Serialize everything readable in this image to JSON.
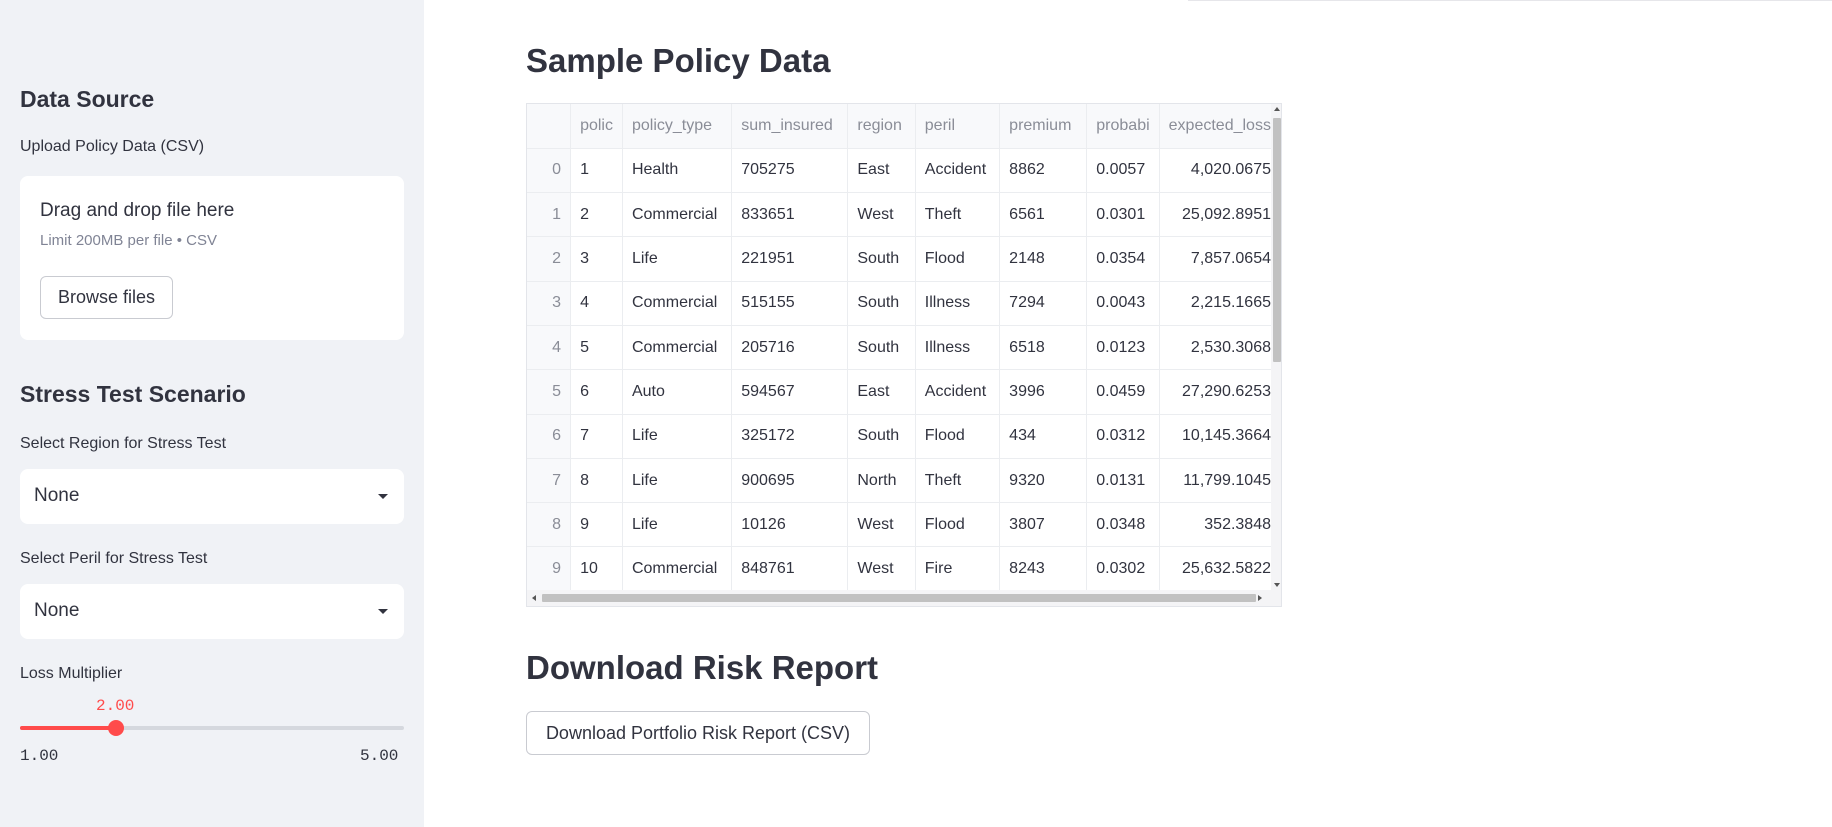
{
  "sidebar": {
    "data_source_heading": "Data Source",
    "upload_label": "Upload Policy Data (CSV)",
    "uploader": {
      "drag_text": "Drag and drop file here",
      "limit_text": "Limit 200MB per file • CSV",
      "browse_label": "Browse files"
    },
    "stress_heading": "Stress Test Scenario",
    "region_label": "Select Region for Stress Test",
    "region_value": "None",
    "peril_label": "Select Peril for Stress Test",
    "peril_value": "None",
    "multiplier_label": "Loss Multiplier",
    "multiplier": {
      "value": "2.00",
      "min": "1.00",
      "max": "5.00",
      "fraction": 0.25
    }
  },
  "main": {
    "sample_title": "Sample Policy Data",
    "table": {
      "columns": [
        "",
        "polic",
        "policy_type",
        "sum_insured",
        "region",
        "peril",
        "premium",
        "probabi",
        "expected_loss"
      ],
      "rows": [
        [
          "0",
          "1",
          "Health",
          "705275",
          "East",
          "Accident",
          "8862",
          "0.0057",
          "4,020.0675"
        ],
        [
          "1",
          "2",
          "Commercial",
          "833651",
          "West",
          "Theft",
          "6561",
          "0.0301",
          "25,092.8951"
        ],
        [
          "2",
          "3",
          "Life",
          "221951",
          "South",
          "Flood",
          "2148",
          "0.0354",
          "7,857.0654"
        ],
        [
          "3",
          "4",
          "Commercial",
          "515155",
          "South",
          "Illness",
          "7294",
          "0.0043",
          "2,215.1665"
        ],
        [
          "4",
          "5",
          "Commercial",
          "205716",
          "South",
          "Illness",
          "6518",
          "0.0123",
          "2,530.3068"
        ],
        [
          "5",
          "6",
          "Auto",
          "594567",
          "East",
          "Accident",
          "3996",
          "0.0459",
          "27,290.6253"
        ],
        [
          "6",
          "7",
          "Life",
          "325172",
          "South",
          "Flood",
          "434",
          "0.0312",
          "10,145.3664"
        ],
        [
          "7",
          "8",
          "Life",
          "900695",
          "North",
          "Theft",
          "9320",
          "0.0131",
          "11,799.1045"
        ],
        [
          "8",
          "9",
          "Life",
          "10126",
          "West",
          "Flood",
          "3807",
          "0.0348",
          "352.3848"
        ],
        [
          "9",
          "10",
          "Commercial",
          "848761",
          "West",
          "Fire",
          "8243",
          "0.0302",
          "25,632.5822"
        ]
      ]
    },
    "download_title": "Download Risk Report",
    "download_button": "Download Portfolio Risk Report (CSV)"
  },
  "colors": {
    "accent": "#ff4b4b",
    "sidebar_bg": "#f0f2f6",
    "text": "#31333f"
  }
}
